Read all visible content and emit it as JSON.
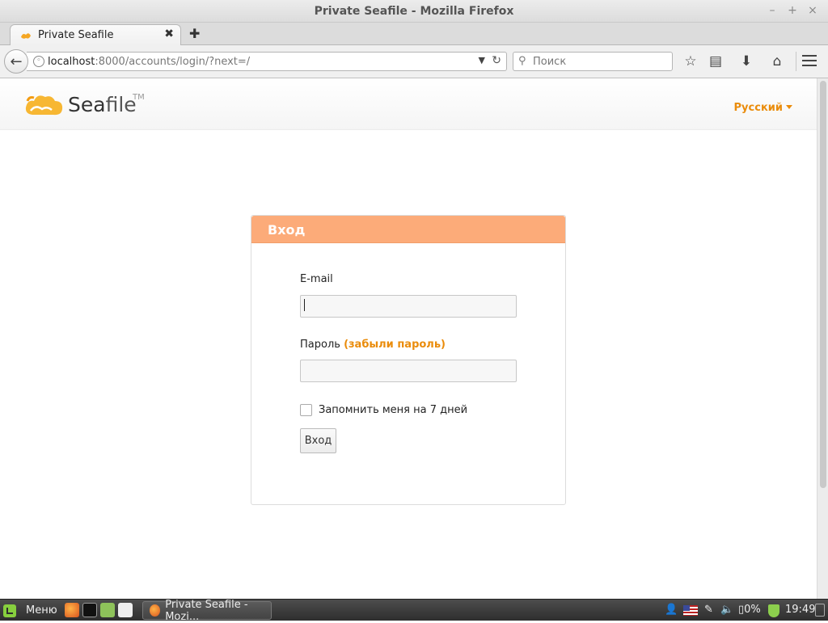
{
  "window": {
    "title": "Private Seafile - Mozilla Firefox",
    "minimize": "–",
    "maximize": "+",
    "close": "×"
  },
  "tabs": [
    {
      "label": "Private Seafile",
      "close": "✖"
    }
  ],
  "new_tab": "✚",
  "navbar": {
    "url_host": "localhost",
    "url_rest": ":8000/accounts/login/?next=/",
    "search_placeholder": "Поиск"
  },
  "site": {
    "logo_text_sea": "Sea",
    "logo_text_file": "file",
    "logo_tm": "TM",
    "language": "Русский"
  },
  "login": {
    "title": "Вход",
    "email_label": "E-mail",
    "email_value": "",
    "password_label": "Пароль",
    "forgot_link": "(забыли пароль)",
    "password_value": "",
    "remember_label": "Запомнить меня на 7 дней",
    "remember_checked": false,
    "submit_label": "Вход"
  },
  "taskbar": {
    "menu_label": "Меню",
    "task_label": "Private Seafile - Mozi...",
    "battery": "0%",
    "time": "19:49"
  },
  "colors": {
    "accent": "#ea8c0b",
    "panel_header": "#fcab79",
    "taskbar": "#3a3a3a"
  }
}
